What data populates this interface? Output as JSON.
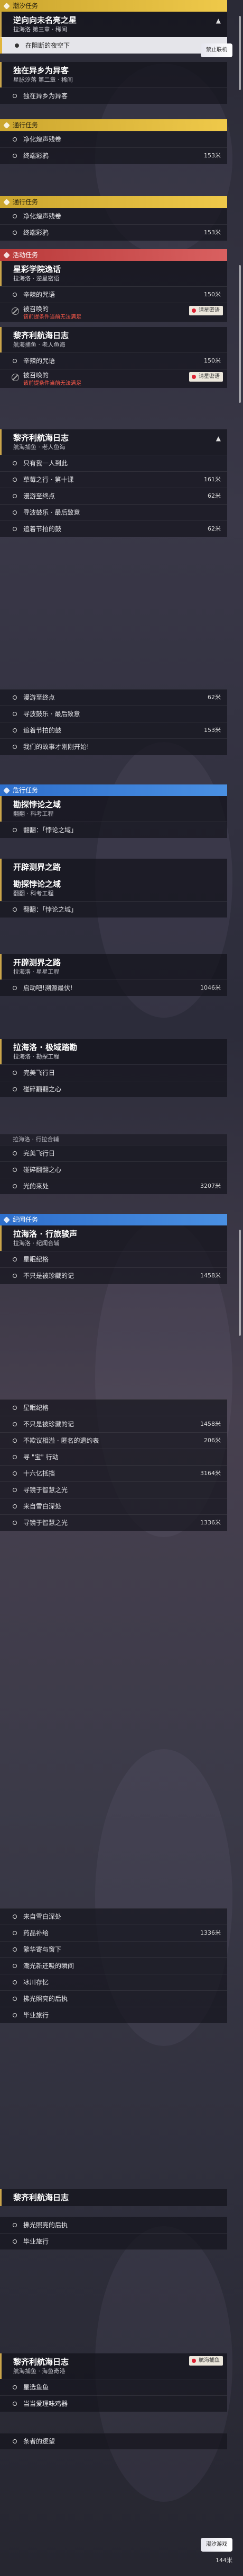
{
  "sections": {
    "s1": {
      "header": "潮汐任务",
      "q1_title": "逆向向未名亮之星",
      "q1_sub": "拉海洛 第三章 · 稀间",
      "item_hl": "在阻断的夜空下",
      "badge": "禁止联机",
      "q2_title": "独在异乡为异客",
      "q2_sub": "星脉汐落 第二章 · 稀间",
      "q2_item": "独在异乡为异客"
    },
    "s2": {
      "header": "通行任务",
      "i1": "净化煌声残卷",
      "i2": "终端彩鸦",
      "d2": "153米"
    },
    "s3": {
      "header": "通行任务",
      "i1": "净化煌声残卷",
      "i2": "终端彩鸦",
      "d2": "153米"
    },
    "s4": {
      "header": "活动任务",
      "q1_title": "星彩学院逸话",
      "q1_sub": "拉海洛 · 逆星密语",
      "i1": "辛辣的咒语",
      "d1": "150米",
      "lock1": "被召唤的",
      "warn1": "该前提条件当前无法满足",
      "tag1": "请星密语",
      "q2_title": "黎齐利航海日志",
      "q2_sub": "航海捕鱼 · 老人鱼海",
      "i2": "辛辣的咒语",
      "d2": "150米",
      "lock2": "被召唤的",
      "warn2": "该前提条件当前无法满足",
      "tag2": "请星密语"
    },
    "s5": {
      "q_title": "黎齐利航海日志",
      "q_sub": "航海捕鱼 · 老人鱼海",
      "i1": "只有我一人到此",
      "i2": "草莓之行 · 第十课",
      "d2": "161米",
      "i3": "漫游至终点",
      "d3": "62米",
      "i4": "寻波鼓乐 · 最后致意",
      "i5": "追着节拍的鼓",
      "d5": "62米"
    },
    "s6": {
      "i1": "漫游至终点",
      "d1": "62米",
      "i2": "寻波鼓乐 · 最后致意",
      "i3": "追着节拍的鼓",
      "d3": "153米",
      "i4": "我们的故事才刚刚开始!"
    },
    "s7": {
      "header": "危行任务",
      "q_title": "勘探悖论之域",
      "q_sub": "翻翻 · 科考工程",
      "i1": "翻翻：「悖论之域」"
    },
    "s8": {
      "q_title": "开辟测界之路",
      "q2_title": "勘探悖论之域",
      "q2_sub": "翻翻 · 科考工程",
      "i1": "翻翻：「悖论之域」"
    },
    "s9": {
      "q_title": "开辟测界之路",
      "q_sub": "拉海洛 · 星星工程",
      "i1": "启动吧!溯源最伏!",
      "d1": "1046米"
    },
    "s10": {
      "q_title": "拉海洛 · 极域踏勘",
      "q_sub": "拉海洛 · 勘探工程",
      "i1": "完美飞行日",
      "i2": "碰碎翻翻之心"
    },
    "s11": {
      "small": "拉海洛 · 行拉合辅",
      "i1": "完美飞行日",
      "i2": "碰碎翻翻之心",
      "i3": "光的来处",
      "d3": "3207米"
    },
    "s12": {
      "header": "纪闻任务",
      "q_title": "拉海洛 · 行旅骏声",
      "q_sub": "拉海洛 · 纪闻合辅",
      "i1": "星眠纪格",
      "i2": "不只是被珍藏的记",
      "d2": "1458米"
    },
    "s13": {
      "i1": "星眠纪格",
      "i2": "不只是被珍藏的记",
      "d2": "1458米",
      "i3": "不欺议相溢 · 匿名的遗约表",
      "d3": "206米",
      "i4": "寻 \"宝\" 行动",
      "i5": "十六亿抵挡",
      "d5": "3164米",
      "i6": "寻镜于智慧之光",
      "i7": "来自雪白深处",
      "i8": "寻镜于智慧之光",
      "d8": "1336米"
    },
    "s14": {
      "i1": "来自雪白深处",
      "i2": "药品补给",
      "d2": "1336米",
      "i3": "繁华寄与窗下",
      "i4": "潮光新还吸的瞬间",
      "i5": "冰川存忆",
      "i6": "拂光照亮的后执",
      "i7": "毕业旅行"
    },
    "s15": {
      "q_title": "黎齐利航海日志",
      "i1": "拂光照亮的后执",
      "i2": "毕业旅行"
    },
    "s16": {
      "q_title": "黎齐利航海日志",
      "q_sub": "航海捕鱼 · 海鱼奇港",
      "tag": "航海捕鱼",
      "i1": "星选鱼鱼",
      "i2": "当当爱理味鸡器",
      "i3": "条者的逻望",
      "badge": "潮汐游戏",
      "dist": "144米"
    }
  }
}
